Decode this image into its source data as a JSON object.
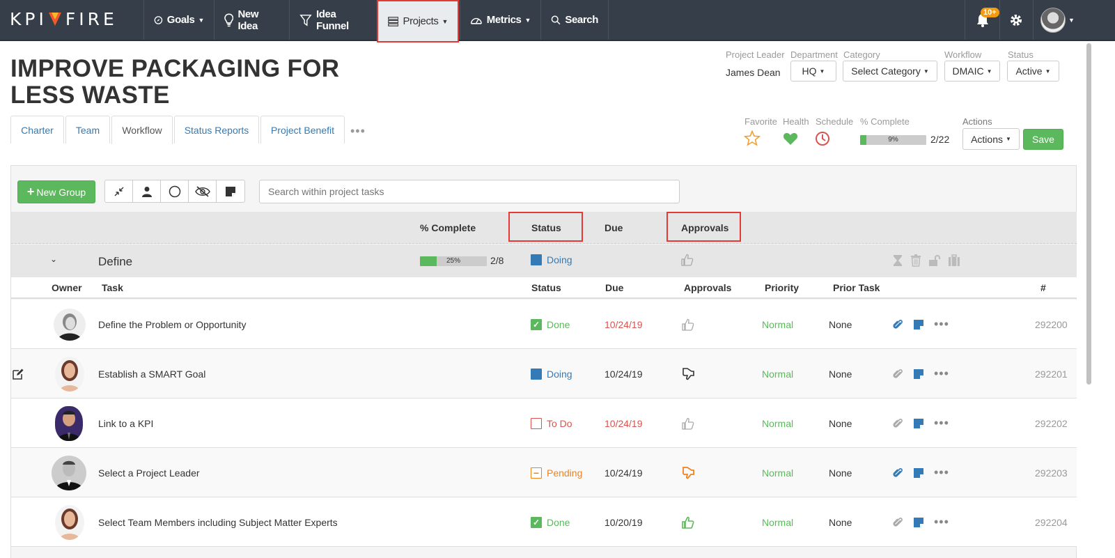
{
  "nav": {
    "logo": "KPI FIRE",
    "items": [
      {
        "label": "Goals",
        "icon": "compass-icon"
      },
      {
        "label": "New Idea",
        "icon": "lightbulb-icon"
      },
      {
        "label": "Idea Funnel",
        "icon": "funnel-icon"
      },
      {
        "label": "Projects",
        "icon": "projects-icon"
      },
      {
        "label": "Metrics",
        "icon": "gauge-icon"
      },
      {
        "label": "Search",
        "icon": "search-icon"
      }
    ],
    "notifications": "10+"
  },
  "project": {
    "title": "IMPROVE PACKAGING FOR LESS WASTE",
    "leader_label": "Project Leader",
    "leader": "James Dean",
    "department_label": "Department",
    "department": "HQ",
    "category_label": "Category",
    "category": "Select Category",
    "workflow_label": "Workflow",
    "workflow": "DMAIC",
    "status_label": "Status",
    "status": "Active",
    "favorite_label": "Favorite",
    "health_label": "Health",
    "schedule_label": "Schedule",
    "complete_label": "% Complete",
    "complete_pct": "9%",
    "complete_fraction": 0.09,
    "complete_count": "2/22",
    "actions_label": "Actions",
    "actions_btn": "Actions",
    "save": "Save"
  },
  "tabs": [
    "Charter",
    "Team",
    "Workflow",
    "Status Reports",
    "Project Benefit"
  ],
  "toolbar": {
    "new_group": "New Group",
    "search_placeholder": "Search within project tasks"
  },
  "columns": {
    "complete": "% Complete",
    "status": "Status",
    "due": "Due",
    "approvals": "Approvals"
  },
  "group": {
    "name": "Define",
    "pct": "25%",
    "fraction": 0.25,
    "count": "2/8",
    "status": "Doing"
  },
  "subheader": {
    "owner": "Owner",
    "task": "Task",
    "status": "Status",
    "due": "Due",
    "approvals": "Approvals",
    "priority": "Priority",
    "prior": "Prior Task",
    "num": "#"
  },
  "colors": {
    "green": "#5cb85c",
    "blue": "#337ab7",
    "red": "#d9534f",
    "orange": "#f0821e"
  },
  "tasks": [
    {
      "task": "Define the Problem or Opportunity",
      "status": "Done",
      "due": "10/24/19",
      "priority": "Normal",
      "prior": "None",
      "id": "292200"
    },
    {
      "task": "Establish a SMART Goal",
      "status": "Doing",
      "due": "10/24/19",
      "priority": "Normal",
      "prior": "None",
      "id": "292201"
    },
    {
      "task": "Link to a KPI",
      "status": "To Do",
      "due": "10/24/19",
      "priority": "Normal",
      "prior": "None",
      "id": "292202"
    },
    {
      "task": "Select a Project Leader",
      "status": "Pending",
      "due": "10/24/19",
      "priority": "Normal",
      "prior": "None",
      "id": "292203"
    },
    {
      "task": "Select Team Members including Subject Matter Experts",
      "status": "Done",
      "due": "10/20/19",
      "priority": "Normal",
      "prior": "None",
      "id": "292204"
    }
  ]
}
